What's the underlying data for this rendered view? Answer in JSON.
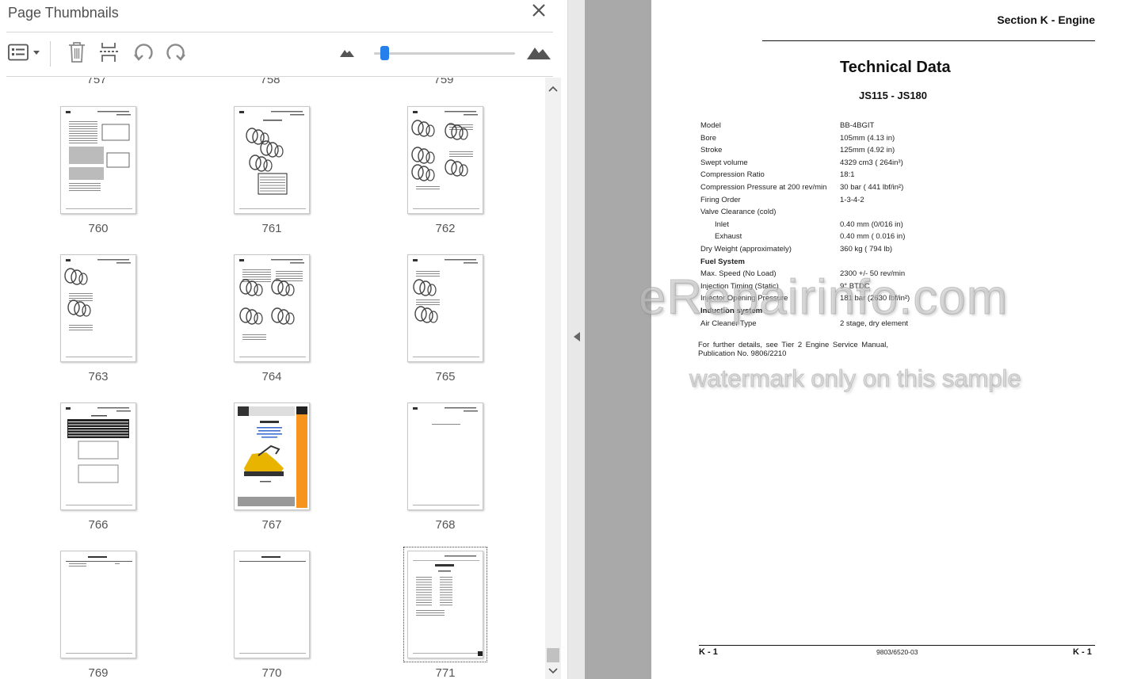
{
  "panel": {
    "title": "Page Thumbnails",
    "prev_row_numbers": [
      "757",
      "758",
      "759"
    ],
    "thumbnails": [
      {
        "number": "760"
      },
      {
        "number": "761"
      },
      {
        "number": "762"
      },
      {
        "number": "763"
      },
      {
        "number": "764"
      },
      {
        "number": "765"
      },
      {
        "number": "766"
      },
      {
        "number": "767"
      },
      {
        "number": "768"
      },
      {
        "number": "769"
      },
      {
        "number": "770"
      },
      {
        "number": "771",
        "selected": true
      }
    ],
    "toolbar": {
      "icons": [
        "thumbnail-options-icon",
        "delete-page-icon",
        "insert-page-icon",
        "rotate-counterclockwise-icon",
        "rotate-clockwise-icon",
        "zoom-out-mountain-icon",
        "zoom-in-mountain-icon"
      ],
      "zoom_fraction": 0.05
    }
  },
  "doc": {
    "section": "Section K - Engine",
    "title": "Technical Data",
    "subtitle": "JS115 - JS180",
    "specs": [
      {
        "label": "Model",
        "value": "BB-4BGIT"
      },
      {
        "label": "Bore",
        "value": "105mm (4.13 in)"
      },
      {
        "label": "Stroke",
        "value": "125mm (4.92 in)"
      },
      {
        "label": "Swept volume",
        "value": "4329 cm3 ( 264in³)"
      },
      {
        "label": "Compression Ratio",
        "value": "18:1"
      },
      {
        "label": "Compression Pressure at 200 rev/min",
        "value": "30 bar ( 441 lbf/in²)"
      },
      {
        "label": "Firing Order",
        "value": "1-3-4-2"
      },
      {
        "label": "Valve Clearance (cold)",
        "value": ""
      },
      {
        "label": "Inlet",
        "value": "0.40 mm (0/016 in)",
        "indent": true
      },
      {
        "label": "Exhaust",
        "value": "0.40 mm ( 0.016 in)",
        "indent": true
      },
      {
        "label": "Dry Weight (approximately)",
        "value": "360 kg ( 794 lb)"
      },
      {
        "label": "Fuel System",
        "value": "",
        "heading": true
      },
      {
        "label": "Max. Speed (No Load)",
        "value": "2300 +/- 50 rev/min"
      },
      {
        "label": "Injection Timing (Static)",
        "value": "9° BTDC"
      },
      {
        "label": "Injector Opening Pressure",
        "value": "181 bar (2630 lbf/in²)"
      },
      {
        "label": "Induction system",
        "value": "",
        "heading": true
      },
      {
        "label": "Air Cleaner Type",
        "value": "2 stage, dry element"
      }
    ],
    "note": "For further details, see Tier 2 Engine Service Manual, Publication No. 9806/2210",
    "footer_left": "K - 1",
    "footer_mid": "9803/6520-03",
    "footer_right": "K - 1"
  },
  "watermark": {
    "main": "eRepairinfo.com",
    "sub": "watermark only on this sample"
  },
  "colors": {
    "accent": "#2680eb",
    "gray_area": "#a9a9a9",
    "jcb_orange": "#f7941d"
  }
}
